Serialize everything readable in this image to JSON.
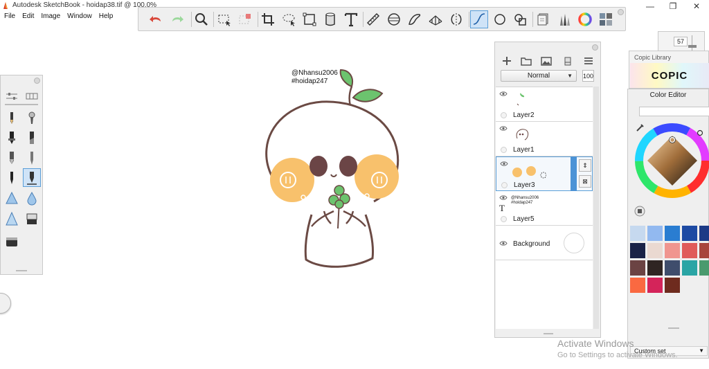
{
  "window": {
    "title": "Autodesk SketchBook - hoidap38.tif @ 100.0%",
    "min_glyph": "—",
    "max_glyph": "❐",
    "close_glyph": "✕"
  },
  "menu": [
    "File",
    "Edit",
    "Image",
    "Window",
    "Help"
  ],
  "toolbar": {
    "icons": [
      "undo-icon",
      "redo-icon",
      "zoom-icon",
      "rect-select-icon",
      "transform-select-icon",
      "crop-icon",
      "lasso-icon",
      "distort-icon",
      "fill-icon",
      "text-icon",
      "ruler-icon",
      "ellipse-guide-icon",
      "french-curve-icon",
      "perspective-icon",
      "symmetry-icon",
      "stroke-tool-icon",
      "shape-icon",
      "copy-icon",
      "brush-library-icon",
      "color-wheel-icon",
      "copic-icon"
    ],
    "active": "stroke-tool-icon"
  },
  "artwork": {
    "watermark_line1": "@Nhansu2006",
    "watermark_line2": "#hoidap247"
  },
  "layer_editor": {
    "blend_mode": "Normal",
    "opacity": "100",
    "layers": [
      {
        "name": "Layer2",
        "visible": true,
        "selected": false
      },
      {
        "name": "Layer1",
        "visible": true,
        "selected": false
      },
      {
        "name": "Layer3",
        "visible": true,
        "selected": true
      },
      {
        "name": "Layer5",
        "visible": true,
        "selected": false,
        "thumb_text": "@Nhansu2006\n#hoidap247"
      },
      {
        "name": "Background",
        "visible": true,
        "selected": false
      }
    ]
  },
  "brush_size": "57",
  "copic_library": {
    "title": "Copic Library",
    "logo": "COPIC"
  },
  "color_editor": {
    "title": "Color Editor",
    "swatches": [
      "#c6d9ef",
      "#92b9f0",
      "#2a7dd1",
      "#1d4aa3",
      "#1c3a86",
      "#1a2247",
      "#ead9d1",
      "#f0958f",
      "#e05b5a",
      "#a8443d",
      "#6b4343",
      "#2f2523",
      "#3f4d6c",
      "#2aa5a5",
      "#4a9a6e",
      "#fa6941",
      "#d4245a",
      "#6e2b1e"
    ],
    "custom_set": "Custom set"
  },
  "activation": {
    "headline": "Activate Windows",
    "subtext": "Go to Settings to activate Windows."
  },
  "colors": {
    "accent": "#4c93d6",
    "panel_bg": "#efefef",
    "outline": "#6b4a44",
    "cheek": "#f8c16c",
    "leaf": "#6cc36e"
  }
}
